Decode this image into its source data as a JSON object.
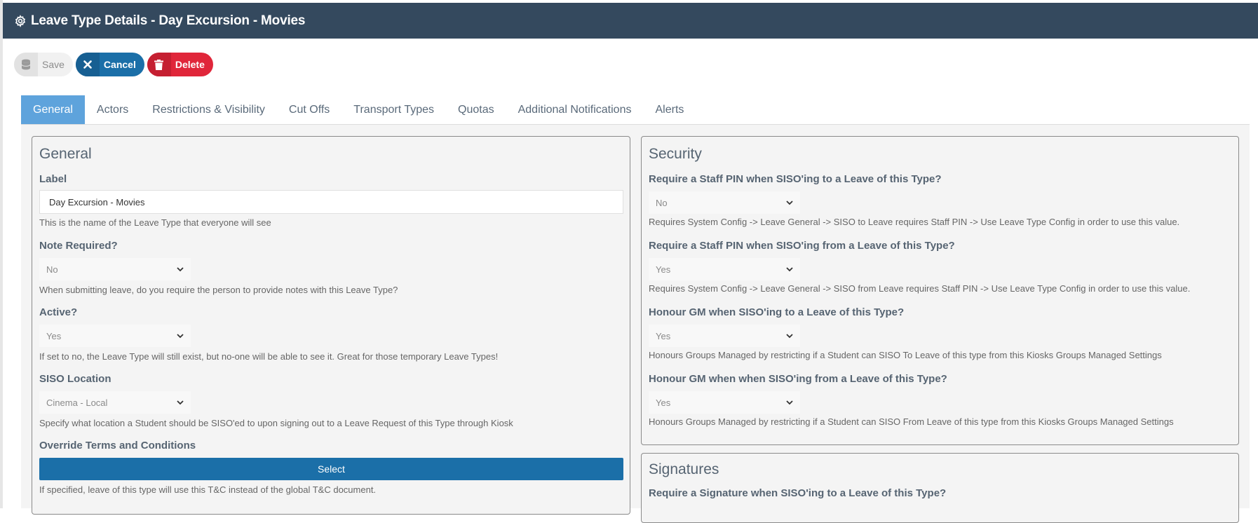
{
  "header": {
    "title": "Leave Type Details - Day Excursion - Movies"
  },
  "toolbar": {
    "save_label": "Save",
    "cancel_label": "Cancel",
    "delete_label": "Delete"
  },
  "tabs": [
    {
      "label": "General",
      "active": true
    },
    {
      "label": "Actors"
    },
    {
      "label": "Restrictions & Visibility"
    },
    {
      "label": "Cut Offs"
    },
    {
      "label": "Transport Types"
    },
    {
      "label": "Quotas"
    },
    {
      "label": "Additional Notifications"
    },
    {
      "label": "Alerts"
    }
  ],
  "general": {
    "title": "General",
    "label_field": {
      "label": "Label",
      "value": "Day Excursion - Movies",
      "help": "This is the name of the Leave Type that everyone will see"
    },
    "note_required": {
      "label": "Note Required?",
      "value": "No",
      "help": "When submitting leave, do you require the person to provide notes with this Leave Type?"
    },
    "active": {
      "label": "Active?",
      "value": "Yes",
      "help": "If set to no, the Leave Type will still exist, but no-one will be able to see it. Great for those temporary Leave Types!"
    },
    "siso_location": {
      "label": "SISO Location",
      "value": "Cinema - Local",
      "help": "Specify what location a Student should be SISO'ed to upon signing out to a Leave Request of this Type through Kiosk"
    },
    "override_terms": {
      "label": "Override Terms and Conditions",
      "button": "Select",
      "help": "If specified, leave of this type will use this T&C instead of the global T&C document."
    }
  },
  "security": {
    "title": "Security",
    "pin_to": {
      "label": "Require a Staff PIN when SISO'ing to a Leave of this Type?",
      "value": "No",
      "help": "Requires System Config -> Leave General -> SISO to Leave requires Staff PIN -> Use Leave Type Config in order to use this value."
    },
    "pin_from": {
      "label": "Require a Staff PIN when SISO'ing from a Leave of this Type?",
      "value": "Yes",
      "help": "Requires System Config -> Leave General -> SISO from Leave requires Staff PIN -> Use Leave Type Config in order to use this value."
    },
    "gm_to": {
      "label": "Honour GM when SISO'ing to a Leave of this Type?",
      "value": "Yes",
      "help": "Honours Groups Managed by restricting if a Student can SISO To Leave of this type from this Kiosks Groups Managed Settings"
    },
    "gm_from": {
      "label": "Honour GM when when SISO'ing from a Leave of this Type?",
      "value": "Yes",
      "help": "Honours Groups Managed by restricting if a Student can SISO From Leave of this type from this Kiosks Groups Managed Settings"
    }
  },
  "signatures": {
    "title": "Signatures",
    "sig_to": {
      "label": "Require a Signature when SISO'ing to a Leave of this Type?"
    }
  },
  "colors": {
    "header_bg": "#34495e",
    "primary": "#1b6fa8",
    "danger": "#e0263a",
    "tab_active": "#5ea3dc"
  },
  "icons": {
    "header": "gear-icon",
    "save": "database-icon",
    "cancel": "close-icon",
    "delete": "trash-icon",
    "select": "chevron-down-icon"
  }
}
